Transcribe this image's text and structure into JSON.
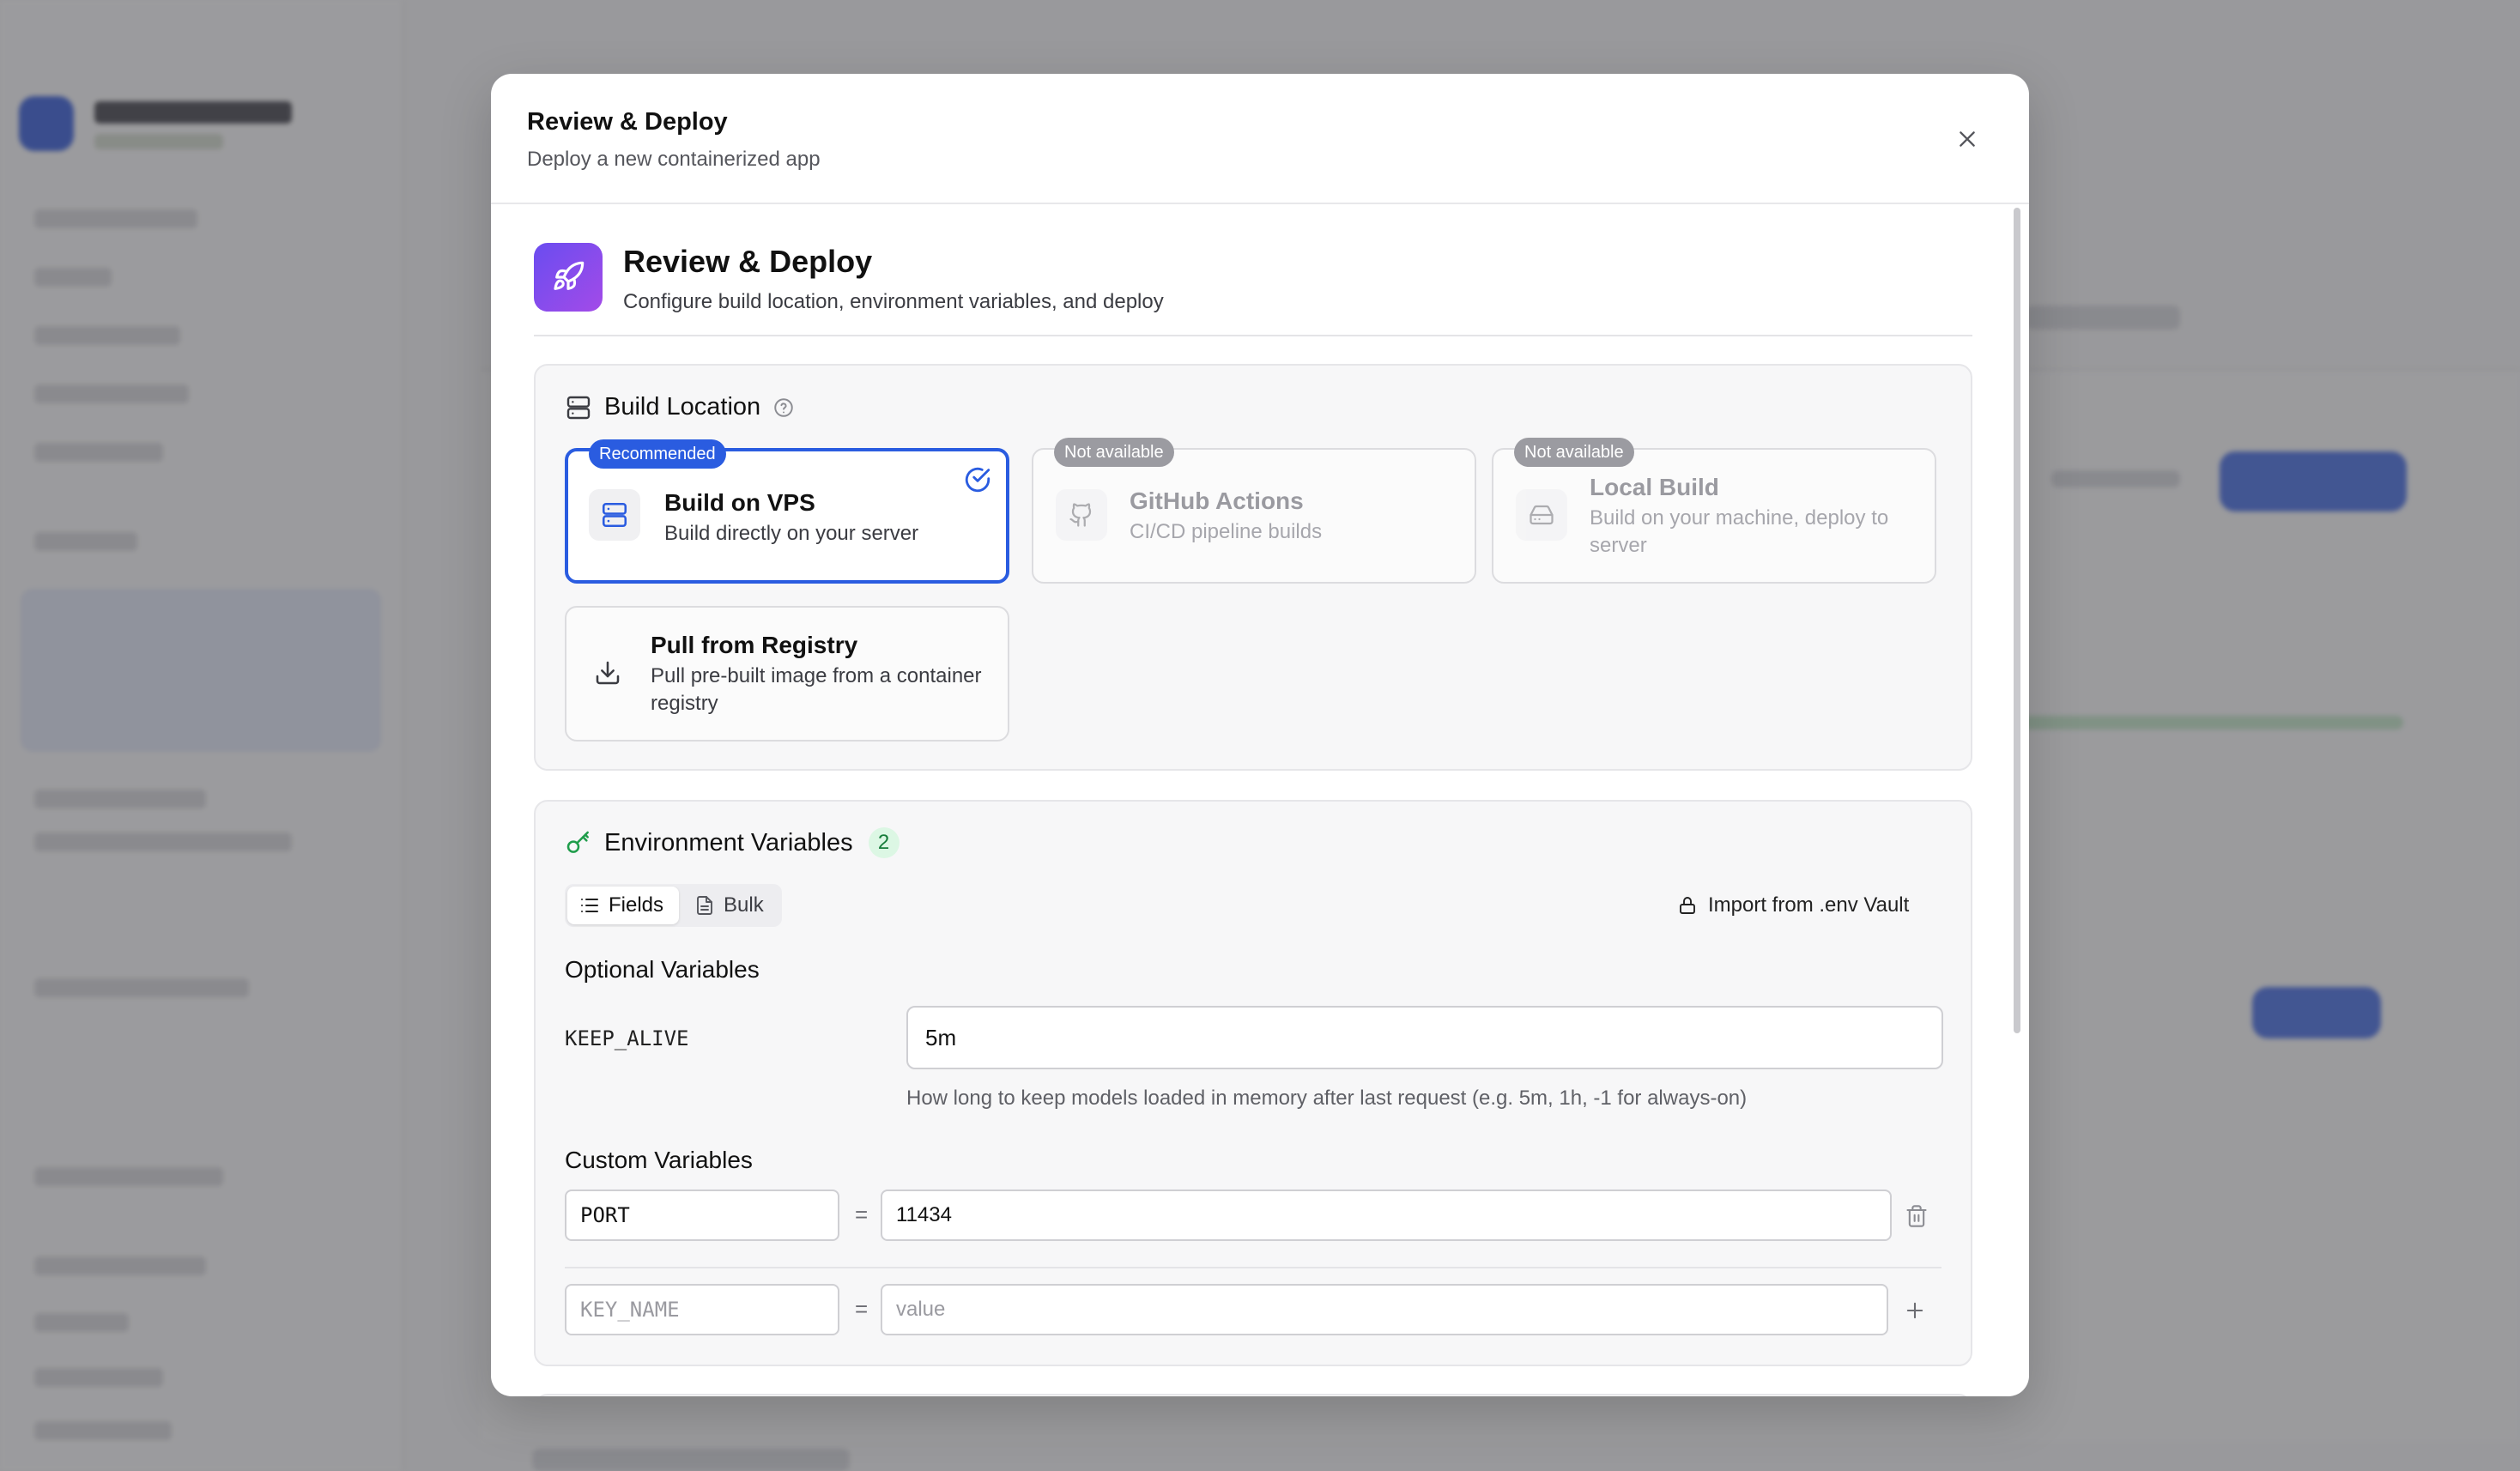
{
  "dialog": {
    "title": "Review & Deploy",
    "subtitle": "Deploy a new containerized app"
  },
  "hero": {
    "title": "Review & Deploy",
    "subtitle": "Configure build location, environment variables, and deploy",
    "icon": "rocket-icon",
    "gradient": [
      "#6a4cf0",
      "#a34be8"
    ]
  },
  "build_location": {
    "title": "Build Location",
    "options": [
      {
        "title": "Build on VPS",
        "desc": "Build directly on your server",
        "tag": "Recommended",
        "selected": true,
        "icon": "server-icon"
      },
      {
        "title": "GitHub Actions",
        "desc": "CI/CD pipeline builds",
        "tag": "Not available",
        "selected": false,
        "icon": "github-icon"
      },
      {
        "title": "Local Build",
        "desc": "Build on your machine, deploy to server",
        "tag": "Not available",
        "selected": false,
        "icon": "hard-drive-icon"
      },
      {
        "title": "Pull from Registry",
        "desc": "Pull pre-built image from a container registry",
        "tag": "",
        "selected": false,
        "icon": "download-icon"
      }
    ]
  },
  "env": {
    "title": "Environment Variables",
    "count": "2",
    "tabs": {
      "fields": "Fields",
      "bulk": "Bulk"
    },
    "import_label": "Import from .env Vault",
    "optional_heading": "Optional Variables",
    "keep_alive": {
      "key": "KEEP_ALIVE",
      "value": "5m",
      "hint": "How long to keep models loaded in memory after last request (e.g. 5m, 1h, -1 for always-on)"
    },
    "custom_heading": "Custom Variables",
    "custom_rows": [
      {
        "key": "PORT",
        "value": "11434"
      }
    ],
    "new_row": {
      "key_placeholder": "KEY_NAME",
      "value_placeholder": "value"
    },
    "equals": "="
  },
  "colors": {
    "accent": "#2a5ce0",
    "badge_green_bg": "#dcf7e4",
    "badge_green_text": "#167c3a",
    "disabled_tag": "#9b9ba1"
  }
}
